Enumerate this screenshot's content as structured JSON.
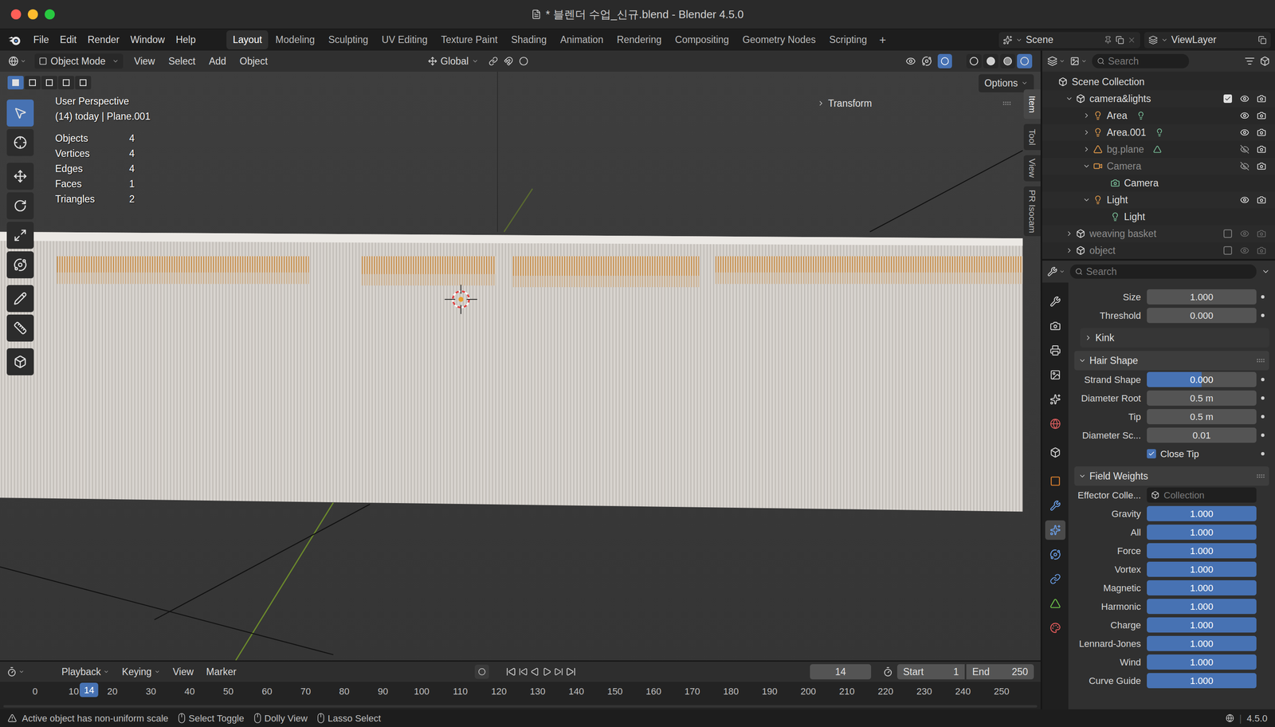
{
  "window": {
    "title": "* 블렌더 수업_신규.blend - Blender 4.5.0"
  },
  "menu": [
    "File",
    "Edit",
    "Render",
    "Window",
    "Help"
  ],
  "workspaces": [
    {
      "label": "Layout",
      "selected": true
    },
    {
      "label": "Modeling",
      "selected": false
    },
    {
      "label": "Sculpting",
      "selected": false
    },
    {
      "label": "UV Editing",
      "selected": false
    },
    {
      "label": "Texture Paint",
      "selected": false
    },
    {
      "label": "Shading",
      "selected": false
    },
    {
      "label": "Animation",
      "selected": false
    },
    {
      "label": "Rendering",
      "selected": false
    },
    {
      "label": "Compositing",
      "selected": false
    },
    {
      "label": "Geometry Nodes",
      "selected": false
    },
    {
      "label": "Scripting",
      "selected": false
    }
  ],
  "add_workspace": "+",
  "scene": "Scene",
  "view_layer": "ViewLayer",
  "viewport_header": {
    "mode": "Object Mode",
    "menus": [
      "View",
      "Select",
      "Add",
      "Object"
    ],
    "orientation": "Global",
    "shading": [
      {
        "selected": false
      },
      {
        "selected": false
      },
      {
        "selected": false
      },
      {
        "selected": true
      }
    ]
  },
  "viewport": {
    "select_modes": [
      {
        "selected": true
      },
      {
        "selected": false
      },
      {
        "selected": false
      },
      {
        "selected": false
      },
      {
        "selected": false
      }
    ],
    "options": "Options",
    "perspective": "User Perspective",
    "context": "(14) today | Plane.001",
    "stats": [
      {
        "label": "Objects",
        "value": "4"
      },
      {
        "label": "Vertices",
        "value": "4"
      },
      {
        "label": "Edges",
        "value": "4"
      },
      {
        "label": "Faces",
        "value": "1"
      },
      {
        "label": "Triangles",
        "value": "2"
      }
    ],
    "tools": [
      {
        "selected": true
      },
      {
        "selected": false
      },
      {
        "selected": false
      },
      {
        "selected": false
      },
      {
        "selected": false
      },
      {
        "selected": false
      },
      {
        "selected": false
      },
      {
        "selected": false
      },
      {
        "selected": false
      }
    ],
    "transform": "Transform",
    "side_tabs": [
      {
        "label": "Item",
        "selected": true
      },
      {
        "label": "Tool",
        "selected": false
      },
      {
        "label": "View",
        "selected": false
      },
      {
        "label": "PR Isocam",
        "selected": false
      }
    ]
  },
  "outliner": {
    "search_placeholder": "Search",
    "root": "Scene Collection",
    "items": [
      {
        "name": "camera&lights",
        "kind": "collection",
        "depth": 0,
        "expanded": true,
        "checked": true,
        "visible": true,
        "renderable": true
      },
      {
        "name": "Area",
        "kind": "light",
        "depth": 1,
        "expanded": false,
        "visible": true,
        "renderable": true
      },
      {
        "name": "Area.001",
        "kind": "light",
        "depth": 1,
        "expanded": false,
        "visible": true,
        "renderable": true
      },
      {
        "name": "bg.plane",
        "kind": "mesh",
        "depth": 1,
        "expanded": false,
        "visible": false,
        "renderable": true
      },
      {
        "name": "Camera",
        "kind": "camera",
        "depth": 1,
        "expanded": true,
        "visible": false,
        "renderable": true
      },
      {
        "name": "Camera",
        "kind": "camera-data",
        "depth": 2
      },
      {
        "name": "Light",
        "kind": "light",
        "depth": 1,
        "expanded": true,
        "visible": true,
        "renderable": true
      },
      {
        "name": "Light",
        "kind": "light-data",
        "depth": 2
      },
      {
        "name": "weaving basket",
        "kind": "collection",
        "depth": 0,
        "checked": false,
        "visible": true,
        "renderable": true
      },
      {
        "name": "object",
        "kind": "collection",
        "depth": 0,
        "checked": false,
        "visible": true,
        "renderable": true
      }
    ]
  },
  "properties": {
    "search_placeholder": "Search",
    "tabs": [
      {
        "selected": false
      },
      {
        "selected": false
      },
      {
        "selected": false
      },
      {
        "selected": false
      },
      {
        "selected": false
      },
      {
        "selected": false
      },
      {
        "selected": false
      },
      {
        "selected": false
      },
      {
        "selected": false
      },
      {
        "selected": true
      },
      {
        "selected": false
      },
      {
        "selected": false
      },
      {
        "selected": false
      },
      {
        "selected": false
      }
    ],
    "rows": [
      {
        "kind": "field",
        "label": "Size",
        "value": "1.000",
        "animatable": true
      },
      {
        "kind": "field",
        "label": "Threshold",
        "value": "0.000",
        "animatable": true
      },
      {
        "kind": "subpanel",
        "label": "Kink",
        "expanded": false
      },
      {
        "kind": "panel",
        "label": "Hair Shape",
        "expanded": true
      },
      {
        "kind": "slider",
        "label": "Strand Shape",
        "value": "0.000",
        "level": 0.5,
        "animatable": true
      },
      {
        "kind": "field",
        "label": "Diameter Root",
        "value": "0.5 m",
        "animatable": true
      },
      {
        "kind": "field",
        "label": "Tip",
        "value": "0.5 m",
        "animatable": true
      },
      {
        "kind": "field",
        "label": "Diameter Sc...",
        "value": "0.01",
        "animatable": true
      },
      {
        "kind": "checkbox",
        "label": "Close Tip",
        "checked": true,
        "animatable": true
      },
      {
        "kind": "panel",
        "label": "Field Weights",
        "expanded": true
      },
      {
        "kind": "collection",
        "label": "Effector Colle...",
        "value": "Collection",
        "animatable": false
      },
      {
        "kind": "slider",
        "label": "Gravity",
        "value": "1.000",
        "level": 1,
        "animatable": false
      },
      {
        "kind": "slider",
        "label": "All",
        "value": "1.000",
        "level": 1,
        "animatable": false
      },
      {
        "kind": "slider",
        "label": "Force",
        "value": "1.000",
        "level": 1,
        "animatable": false
      },
      {
        "kind": "slider",
        "label": "Vortex",
        "value": "1.000",
        "level": 1,
        "animatable": false
      },
      {
        "kind": "slider",
        "label": "Magnetic",
        "value": "1.000",
        "level": 1,
        "animatable": false
      },
      {
        "kind": "slider",
        "label": "Harmonic",
        "value": "1.000",
        "level": 1,
        "animatable": false
      },
      {
        "kind": "slider",
        "label": "Charge",
        "value": "1.000",
        "level": 1,
        "animatable": false
      },
      {
        "kind": "slider",
        "label": "Lennard-Jones",
        "value": "1.000",
        "level": 1,
        "animatable": false
      },
      {
        "kind": "slider",
        "label": "Wind",
        "value": "1.000",
        "level": 1,
        "animatable": false
      },
      {
        "kind": "slider",
        "label": "Curve Guide",
        "value": "1.000",
        "level": 1,
        "animatable": false
      }
    ]
  },
  "timeline": {
    "menus": [
      {
        "label": "Playback",
        "dropdown": true
      },
      {
        "label": "Keying",
        "dropdown": true
      },
      {
        "label": "View",
        "dropdown": false
      },
      {
        "label": "Marker",
        "dropdown": false
      }
    ],
    "current_frame": "14",
    "start_label": "Start",
    "start": "1",
    "end_label": "End",
    "end": "250",
    "ruler": [
      "0",
      "10",
      "20",
      "30",
      "40",
      "50",
      "60",
      "70",
      "80",
      "90",
      "100",
      "110",
      "120",
      "130",
      "140",
      "150",
      "160",
      "170",
      "180",
      "190",
      "200",
      "210",
      "220",
      "230",
      "240",
      "250"
    ]
  },
  "status_bar": {
    "message": "Active object has non-uniform scale",
    "hints": [
      "Select Toggle",
      "Dolly View",
      "Lasso Select"
    ],
    "version": "4.5.0"
  }
}
